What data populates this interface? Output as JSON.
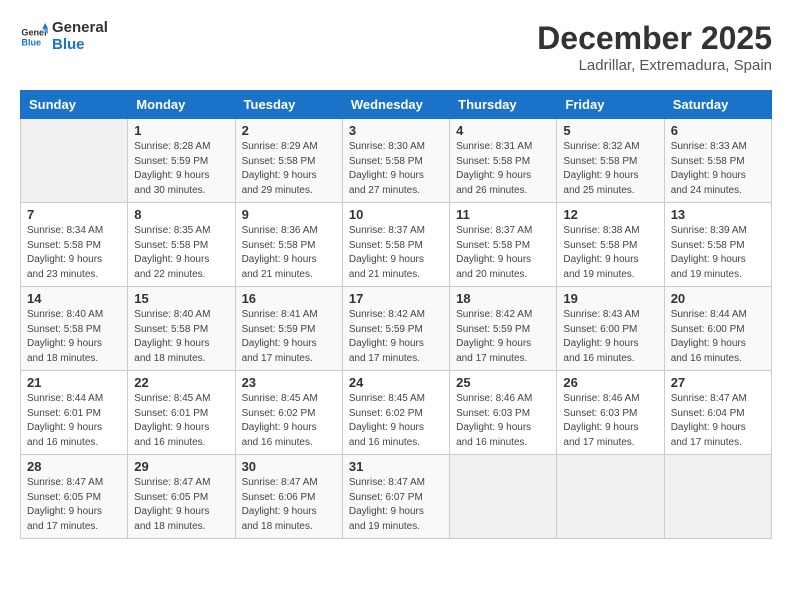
{
  "logo": {
    "line1": "General",
    "line2": "Blue"
  },
  "title": "December 2025",
  "location": "Ladrillar, Extremadura, Spain",
  "days_of_week": [
    "Sunday",
    "Monday",
    "Tuesday",
    "Wednesday",
    "Thursday",
    "Friday",
    "Saturday"
  ],
  "weeks": [
    [
      {
        "day": "",
        "info": ""
      },
      {
        "day": "1",
        "info": "Sunrise: 8:28 AM\nSunset: 5:59 PM\nDaylight: 9 hours\nand 30 minutes."
      },
      {
        "day": "2",
        "info": "Sunrise: 8:29 AM\nSunset: 5:58 PM\nDaylight: 9 hours\nand 29 minutes."
      },
      {
        "day": "3",
        "info": "Sunrise: 8:30 AM\nSunset: 5:58 PM\nDaylight: 9 hours\nand 27 minutes."
      },
      {
        "day": "4",
        "info": "Sunrise: 8:31 AM\nSunset: 5:58 PM\nDaylight: 9 hours\nand 26 minutes."
      },
      {
        "day": "5",
        "info": "Sunrise: 8:32 AM\nSunset: 5:58 PM\nDaylight: 9 hours\nand 25 minutes."
      },
      {
        "day": "6",
        "info": "Sunrise: 8:33 AM\nSunset: 5:58 PM\nDaylight: 9 hours\nand 24 minutes."
      }
    ],
    [
      {
        "day": "7",
        "info": "Sunrise: 8:34 AM\nSunset: 5:58 PM\nDaylight: 9 hours\nand 23 minutes."
      },
      {
        "day": "8",
        "info": "Sunrise: 8:35 AM\nSunset: 5:58 PM\nDaylight: 9 hours\nand 22 minutes."
      },
      {
        "day": "9",
        "info": "Sunrise: 8:36 AM\nSunset: 5:58 PM\nDaylight: 9 hours\nand 21 minutes."
      },
      {
        "day": "10",
        "info": "Sunrise: 8:37 AM\nSunset: 5:58 PM\nDaylight: 9 hours\nand 21 minutes."
      },
      {
        "day": "11",
        "info": "Sunrise: 8:37 AM\nSunset: 5:58 PM\nDaylight: 9 hours\nand 20 minutes."
      },
      {
        "day": "12",
        "info": "Sunrise: 8:38 AM\nSunset: 5:58 PM\nDaylight: 9 hours\nand 19 minutes."
      },
      {
        "day": "13",
        "info": "Sunrise: 8:39 AM\nSunset: 5:58 PM\nDaylight: 9 hours\nand 19 minutes."
      }
    ],
    [
      {
        "day": "14",
        "info": "Sunrise: 8:40 AM\nSunset: 5:58 PM\nDaylight: 9 hours\nand 18 minutes."
      },
      {
        "day": "15",
        "info": "Sunrise: 8:40 AM\nSunset: 5:58 PM\nDaylight: 9 hours\nand 18 minutes."
      },
      {
        "day": "16",
        "info": "Sunrise: 8:41 AM\nSunset: 5:59 PM\nDaylight: 9 hours\nand 17 minutes."
      },
      {
        "day": "17",
        "info": "Sunrise: 8:42 AM\nSunset: 5:59 PM\nDaylight: 9 hours\nand 17 minutes."
      },
      {
        "day": "18",
        "info": "Sunrise: 8:42 AM\nSunset: 5:59 PM\nDaylight: 9 hours\nand 17 minutes."
      },
      {
        "day": "19",
        "info": "Sunrise: 8:43 AM\nSunset: 6:00 PM\nDaylight: 9 hours\nand 16 minutes."
      },
      {
        "day": "20",
        "info": "Sunrise: 8:44 AM\nSunset: 6:00 PM\nDaylight: 9 hours\nand 16 minutes."
      }
    ],
    [
      {
        "day": "21",
        "info": "Sunrise: 8:44 AM\nSunset: 6:01 PM\nDaylight: 9 hours\nand 16 minutes."
      },
      {
        "day": "22",
        "info": "Sunrise: 8:45 AM\nSunset: 6:01 PM\nDaylight: 9 hours\nand 16 minutes."
      },
      {
        "day": "23",
        "info": "Sunrise: 8:45 AM\nSunset: 6:02 PM\nDaylight: 9 hours\nand 16 minutes."
      },
      {
        "day": "24",
        "info": "Sunrise: 8:45 AM\nSunset: 6:02 PM\nDaylight: 9 hours\nand 16 minutes."
      },
      {
        "day": "25",
        "info": "Sunrise: 8:46 AM\nSunset: 6:03 PM\nDaylight: 9 hours\nand 16 minutes."
      },
      {
        "day": "26",
        "info": "Sunrise: 8:46 AM\nSunset: 6:03 PM\nDaylight: 9 hours\nand 17 minutes."
      },
      {
        "day": "27",
        "info": "Sunrise: 8:47 AM\nSunset: 6:04 PM\nDaylight: 9 hours\nand 17 minutes."
      }
    ],
    [
      {
        "day": "28",
        "info": "Sunrise: 8:47 AM\nSunset: 6:05 PM\nDaylight: 9 hours\nand 17 minutes."
      },
      {
        "day": "29",
        "info": "Sunrise: 8:47 AM\nSunset: 6:05 PM\nDaylight: 9 hours\nand 18 minutes."
      },
      {
        "day": "30",
        "info": "Sunrise: 8:47 AM\nSunset: 6:06 PM\nDaylight: 9 hours\nand 18 minutes."
      },
      {
        "day": "31",
        "info": "Sunrise: 8:47 AM\nSunset: 6:07 PM\nDaylight: 9 hours\nand 19 minutes."
      },
      {
        "day": "",
        "info": ""
      },
      {
        "day": "",
        "info": ""
      },
      {
        "day": "",
        "info": ""
      }
    ]
  ]
}
